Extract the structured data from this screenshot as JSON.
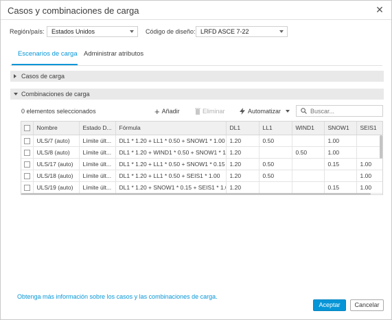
{
  "dialog": {
    "title": "Casos y combinaciones de carga"
  },
  "filters": {
    "region_label": "Región/país:",
    "region_value": "Estados Unidos",
    "code_label": "Código de diseño:",
    "code_value": "LRFD ASCE 7-22"
  },
  "tabs": [
    {
      "label": "Escenarios de carga",
      "active": true
    },
    {
      "label": "Administrar atributos",
      "active": false
    }
  ],
  "sections": {
    "load_cases": "Casos de carga",
    "load_combinations": "Combinaciones de carga"
  },
  "toolbar": {
    "selected_count": "0 elementos seleccionados",
    "add_label": "Añadir",
    "delete_label": "Eliminar",
    "automate_label": "Automatizar",
    "search_placeholder": "Buscar..."
  },
  "table": {
    "columns": [
      "Nombre",
      "Estado D...",
      "Fórmula",
      "DL1",
      "LL1",
      "WIND1",
      "SNOW1",
      "SEIS1"
    ],
    "rows": [
      [
        "ULS/7 (auto)",
        "Límite últ...",
        "DL1 * 1.20 + LL1 * 0.50 + SNOW1 * 1.00",
        "1.20",
        "0.50",
        "",
        "1.00",
        ""
      ],
      [
        "ULS/8 (auto)",
        "Límite últ...",
        "DL1 * 1.20 + WIND1 * 0.50 + SNOW1 * 1...",
        "1.20",
        "",
        "0.50",
        "1.00",
        ""
      ],
      [
        "ULS/17 (auto)",
        "Límite últ...",
        "DL1 * 1.20 + LL1 * 0.50 + SNOW1 * 0.15 ...",
        "1.20",
        "0.50",
        "",
        "0.15",
        "1.00"
      ],
      [
        "ULS/18 (auto)",
        "Límite últ...",
        "DL1 * 1.20 + LL1 * 0.50 + SEIS1 * 1.00",
        "1.20",
        "0.50",
        "",
        "",
        "1.00"
      ],
      [
        "ULS/19 (auto)",
        "Límite últ...",
        "DL1 * 1.20 + SNOW1 * 0.15 + SEIS1 * 1.00",
        "1.20",
        "",
        "",
        "0.15",
        "1.00"
      ]
    ]
  },
  "footer": {
    "info_link": "Obtenga más información sobre los casos y las combinaciones de carga.",
    "accept_label": "Aceptar",
    "cancel_label": "Cancelar"
  },
  "colors": {
    "accent": "#0696d7",
    "section_bg": "#e9e9e9",
    "header_bg": "#f0f0f0"
  }
}
